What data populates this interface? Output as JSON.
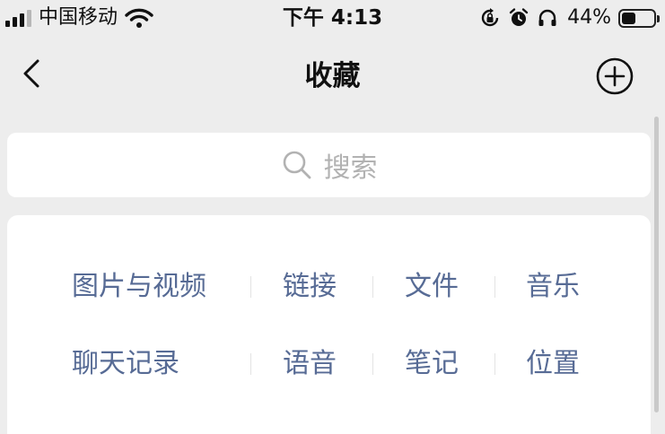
{
  "status_bar": {
    "carrier": "中国移动",
    "time": "下午 4:13",
    "battery_percent_text": "44%",
    "battery_level": 0.44,
    "icons": [
      "signal-icon",
      "wifi-icon",
      "rotation-lock-icon",
      "alarm-icon",
      "headphones-icon",
      "battery-icon"
    ]
  },
  "nav": {
    "title": "收藏",
    "back_icon": "chevron-left-icon",
    "add_icon": "circle-plus-icon"
  },
  "search": {
    "placeholder": "搜索",
    "icon": "search-icon"
  },
  "categories": {
    "row1": [
      "图片与视频",
      "链接",
      "文件",
      "音乐"
    ],
    "row2": [
      "聊天记录",
      "语音",
      "笔记",
      "位置"
    ]
  },
  "colors": {
    "background": "#ededed",
    "card": "#ffffff",
    "category_text": "#576b95",
    "placeholder": "#b2b2b2"
  }
}
